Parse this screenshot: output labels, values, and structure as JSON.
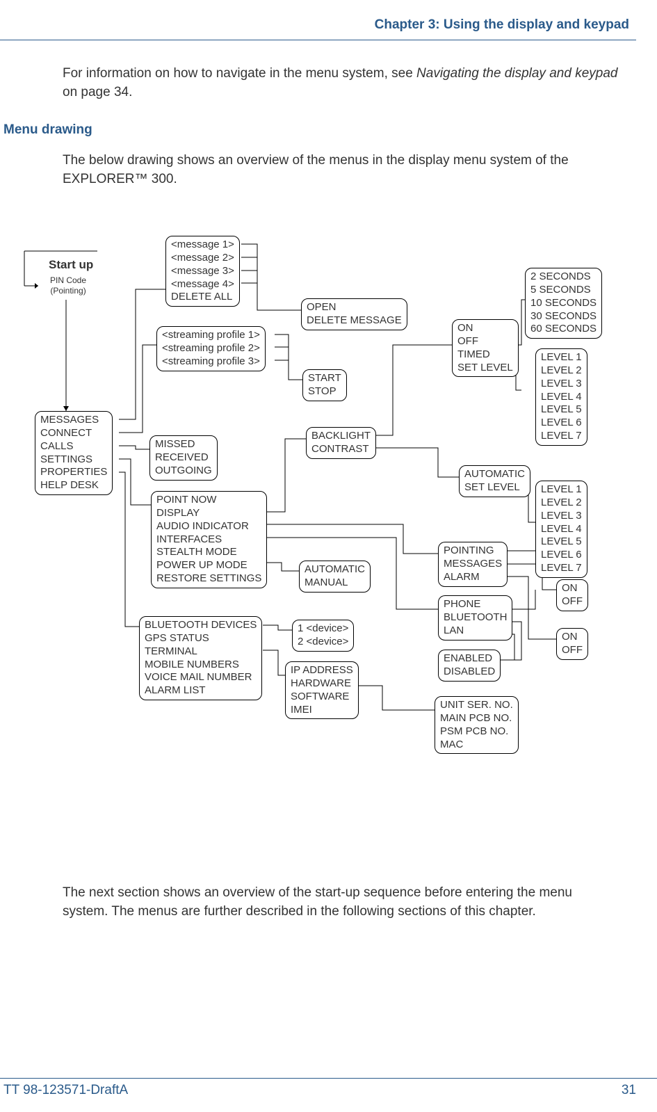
{
  "header": {
    "chapter": "Chapter 3: Using the display and keypad"
  },
  "intro": {
    "text_before": "For information on how to navigate in the menu system, see ",
    "italic": "Navigating the display and keypad",
    "text_after": " on page 34."
  },
  "section_heading": "Menu drawing",
  "section_text": "The below drawing shows an overview of the menus in the display menu system of the EXPLORER™ 300.",
  "startup": {
    "title": "Start up",
    "sub1": "PIN Code",
    "sub2": "(Pointing)"
  },
  "nodes": {
    "main": [
      "MESSAGES",
      "CONNECT",
      "CALLS",
      "SETTINGS",
      "PROPERTIES",
      "HELP DESK"
    ],
    "messages_list": [
      "<message 1>",
      "<message 2>",
      "<message 3>",
      "<message 4>",
      "DELETE ALL"
    ],
    "open_delete": [
      "OPEN",
      "DELETE MESSAGE"
    ],
    "streaming": [
      "<streaming profile 1>",
      "<streaming profile 2>",
      "<streaming profile 3>"
    ],
    "start_stop": [
      "START",
      "STOP"
    ],
    "calls": [
      "MISSED",
      "RECEIVED",
      "OUTGOING"
    ],
    "settings": [
      "POINT NOW",
      "DISPLAY",
      "AUDIO INDICATOR",
      "INTERFACES",
      "STEALTH MODE",
      "POWER UP MODE",
      "RESTORE SETTINGS"
    ],
    "properties": [
      "BLUETOOTH DEVICES",
      "GPS STATUS",
      "TERMINAL",
      "MOBILE NUMBERS",
      "VOICE MAIL NUMBER",
      "ALARM LIST"
    ],
    "backlight_contrast": [
      "BACKLIGHT",
      "CONTRAST"
    ],
    "onoff_timed": [
      "ON",
      "OFF",
      "TIMED",
      "SET LEVEL"
    ],
    "seconds": [
      "2 SECONDS",
      "5 SECONDS",
      "10 SECONDS",
      "30 SECONDS",
      "60 SECONDS"
    ],
    "levels1": [
      "LEVEL 1",
      "LEVEL 2",
      "LEVEL 3",
      "LEVEL 4",
      "LEVEL 5",
      "LEVEL 6",
      "LEVEL 7"
    ],
    "auto_set": [
      "AUTOMATIC",
      "SET LEVEL"
    ],
    "levels2": [
      "LEVEL 1",
      "LEVEL 2",
      "LEVEL 3",
      "LEVEL 4",
      "LEVEL 5",
      "LEVEL 6",
      "LEVEL 7"
    ],
    "pointing_msgs": [
      "POINTING",
      "MESSAGES",
      "ALARM"
    ],
    "auto_manual": [
      "AUTOMATIC",
      "MANUAL"
    ],
    "phone_bt": [
      "PHONE",
      "BLUETOOTH",
      "LAN"
    ],
    "onoff1": [
      "ON",
      "OFF"
    ],
    "onoff2": [
      "ON",
      "OFF"
    ],
    "enabled": [
      "ENABLED",
      "DISABLED"
    ],
    "devices": [
      "1 <device>",
      "2 <device>"
    ],
    "ip": [
      "IP ADDRESS",
      "HARDWARE",
      "SOFTWARE",
      "IMEI"
    ],
    "unit": [
      "UNIT SER. NO.",
      "MAIN PCB NO.",
      "PSM PCB NO.",
      "MAC"
    ]
  },
  "conclusion": "The next section shows an overview of the start-up sequence before entering the menu system. The menus are further described in the following sections of this chapter.",
  "footer": {
    "left": "TT 98-123571-DraftA",
    "right": "31"
  }
}
